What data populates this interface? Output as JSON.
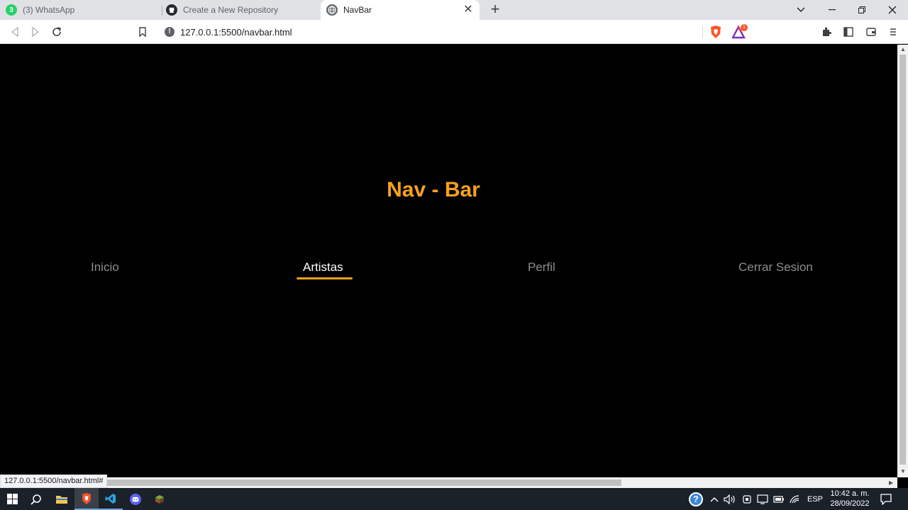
{
  "browser": {
    "tabs": [
      {
        "label": "(3) WhatsApp",
        "icon": "whatsapp-icon",
        "badge": "3"
      },
      {
        "label": "Create a New Repository",
        "icon": "github-icon"
      },
      {
        "label": "NavBar",
        "icon": "globe-icon",
        "active": true
      }
    ],
    "close_glyph": "✕",
    "new_tab_glyph": "+",
    "url": "127.0.0.1:5500/navbar.html",
    "info_glyph": "!",
    "brave_shield_badge": "1",
    "status_url": "127.0.0.1:5500/navbar.html#"
  },
  "page": {
    "title": "Nav - Bar",
    "nav": [
      {
        "label": "Inicio"
      },
      {
        "label": "Artistas",
        "active": true
      },
      {
        "label": "Perfil"
      },
      {
        "label": "Cerrar Sesion"
      }
    ],
    "accent_color": "#f7a21b"
  },
  "taskbar": {
    "language": "ESP",
    "time": "10:42 a. m.",
    "date": "28/09/2022",
    "help_badge": "?"
  }
}
